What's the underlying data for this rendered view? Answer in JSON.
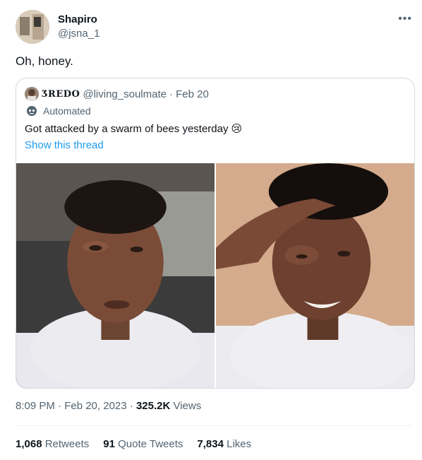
{
  "author": {
    "name": "Shapiro",
    "handle": "@jsna_1"
  },
  "more_icon": "more-horizontal-icon",
  "tweet": {
    "text": "Oh, honey."
  },
  "quote": {
    "name": "ƷREDO",
    "handle": "@living_soulmate",
    "date": "· Feb 20",
    "automated_label": "Automated",
    "text": "Got attacked by a swarm of bees yesterday",
    "emoji": "😢",
    "show_thread": "Show this thread"
  },
  "meta": {
    "time": "8:09 PM · Feb 20, 2023 ·",
    "views_count": "325.2K",
    "views_label": "Views"
  },
  "stats": {
    "retweets_count": "1,068",
    "retweets_label": "Retweets",
    "quotes_count": "91",
    "quotes_label": "Quote Tweets",
    "likes_count": "7,834",
    "likes_label": "Likes"
  },
  "colors": {
    "accent": "#1d9bf0",
    "secondary_text": "#536471",
    "border": "#cfd9de"
  }
}
